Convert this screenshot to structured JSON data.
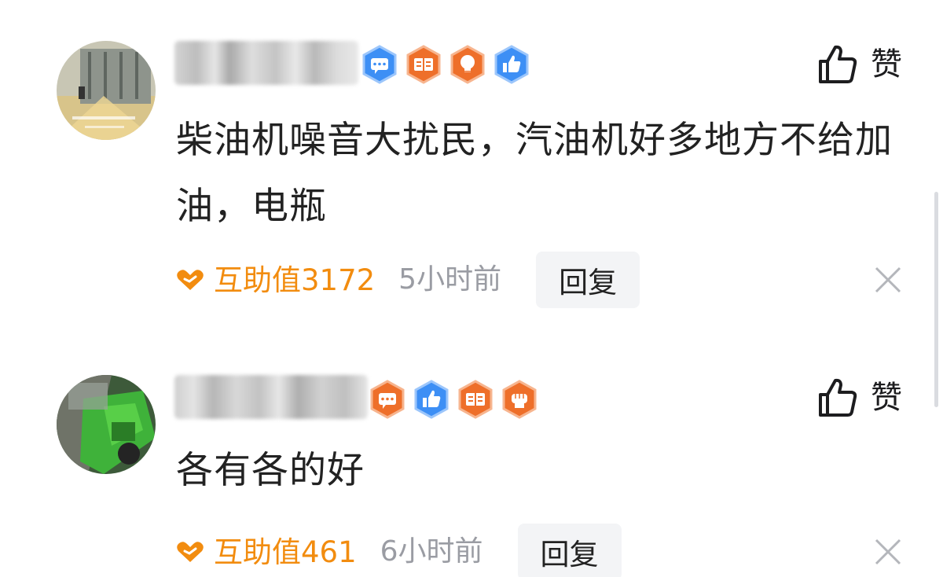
{
  "comments": [
    {
      "username": "",
      "badges": [
        "chat-badge-icon",
        "book-badge-icon",
        "bulb-badge-icon",
        "thumb-badge-icon"
      ],
      "like_label": "赞",
      "content": "柴油机噪音大扰民，汽油机好多地方不给加油，电瓶",
      "help_text": "互助值3172",
      "time": "5小时前",
      "reply_label": "回复"
    },
    {
      "username": "",
      "badges": [
        "chat-badge-icon",
        "thumb-badge-icon",
        "book-badge-icon",
        "fist-badge-icon"
      ],
      "like_label": "赞",
      "content": "各有各的好",
      "help_text": "互助值461",
      "time": "6小时前",
      "reply_label": "回复"
    }
  ],
  "colors": {
    "accent_orange": "#f28c0f",
    "badge_blue": "#3d8ff5",
    "badge_orange": "#ee6f2a",
    "time_gray": "#9a9ca3",
    "reply_bg": "#f3f4f6"
  }
}
